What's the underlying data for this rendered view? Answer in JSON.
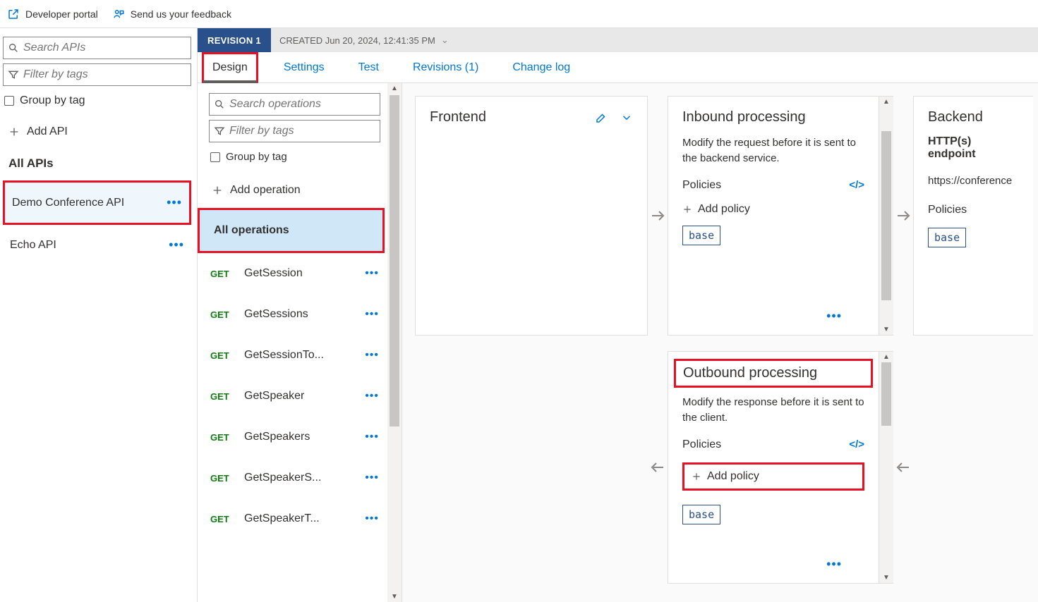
{
  "topbar": {
    "dev_portal": "Developer portal",
    "feedback": "Send us your feedback"
  },
  "sidebar": {
    "search_placeholder": "Search APIs",
    "filter_placeholder": "Filter by tags",
    "group_by_tag": "Group by tag",
    "add_api": "Add API",
    "all_apis": "All APIs",
    "apis": [
      {
        "name": "Demo Conference API",
        "selected": true
      },
      {
        "name": "Echo API",
        "selected": false
      }
    ]
  },
  "revision": {
    "label": "REVISION 1",
    "meta": "CREATED Jun 20, 2024, 12:41:35 PM"
  },
  "tabs": {
    "design": "Design",
    "settings": "Settings",
    "test": "Test",
    "revisions": "Revisions (1)",
    "changelog": "Change log"
  },
  "ops": {
    "search_placeholder": "Search operations",
    "filter_placeholder": "Filter by tags",
    "group_by_tag": "Group by tag",
    "add_operation": "Add operation",
    "all_operations": "All operations",
    "items": [
      {
        "method": "GET",
        "name": "GetSession"
      },
      {
        "method": "GET",
        "name": "GetSessions"
      },
      {
        "method": "GET",
        "name": "GetSessionTo..."
      },
      {
        "method": "GET",
        "name": "GetSpeaker"
      },
      {
        "method": "GET",
        "name": "GetSpeakers"
      },
      {
        "method": "GET",
        "name": "GetSpeakerS..."
      },
      {
        "method": "GET",
        "name": "GetSpeakerT..."
      }
    ]
  },
  "canvas": {
    "frontend": {
      "title": "Frontend"
    },
    "inbound": {
      "title": "Inbound processing",
      "desc": "Modify the request before it is sent to the backend service.",
      "policies": "Policies",
      "add_policy": "Add policy",
      "base": "base"
    },
    "backend": {
      "title": "Backend",
      "endpoint_label": "HTTP(s) endpoint",
      "endpoint_url": "https://conference",
      "policies": "Policies",
      "base": "base"
    },
    "outbound": {
      "title": "Outbound processing",
      "desc": "Modify the response before it is sent to the client.",
      "policies": "Policies",
      "add_policy": "Add policy",
      "base": "base"
    }
  }
}
